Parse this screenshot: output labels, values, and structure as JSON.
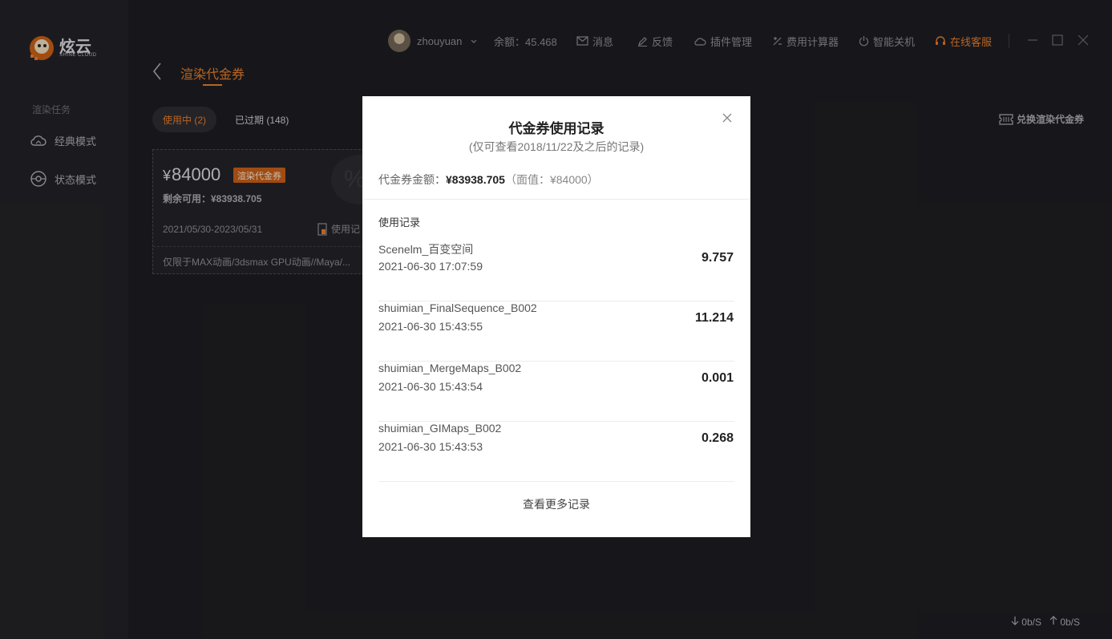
{
  "app": {
    "logo_text": "炫云",
    "logo_sub": "SHINE CLOUD"
  },
  "sidebar": {
    "section_label": "渲染任务",
    "items": [
      {
        "label": "经典模式",
        "icon": "cloud-icon"
      },
      {
        "label": "状态模式",
        "icon": "radar-icon"
      }
    ]
  },
  "topbar": {
    "username": "zhouyuan",
    "balance": "余额：45.468",
    "messages": "消息",
    "feedback": "反馈",
    "plugins": "插件管理",
    "calculator": "费用计算器",
    "shutdown": "智能关机",
    "support": "在线客服",
    "accent_color": "#e27a2b"
  },
  "page": {
    "title": "渲染代金券",
    "tabs": [
      {
        "label": "使用中 (2)",
        "active": true
      },
      {
        "label": "已过期 (148)",
        "active": false
      }
    ],
    "redeem_label": "兑换渲染代金券"
  },
  "voucher_card": {
    "currency": "¥",
    "amount": "84000",
    "tag": "渲染代金券",
    "remaining": "剩余可用：¥83938.705",
    "bg_symbol": "%",
    "date_range": "2021/05/30-2023/05/31",
    "use_record_label": "使用记",
    "limit_text": "仅限于MAX动画/3dsmax GPU动画//Maya/..."
  },
  "modal": {
    "title": "代金券使用记录",
    "subtitle": "(仅可查看2018/11/22及之后的记录)",
    "amount_label": "代金券金额：",
    "amount_value": "¥83938.705",
    "face_value": "（面值：¥84000）",
    "records_label": "使用记录",
    "records": [
      {
        "name": "Scenelm_百变空间",
        "time": "2021-06-30 17:07:59",
        "value": "9.757"
      },
      {
        "name": "shuimian_FinalSequence_B002",
        "time": "2021-06-30 15:43:55",
        "value": "11.214"
      },
      {
        "name": "shuimian_MergeMaps_B002",
        "time": "2021-06-30 15:43:54",
        "value": "0.001"
      },
      {
        "name": "shuimian_GIMaps_B002",
        "time": "2021-06-30 15:43:53",
        "value": "0.268"
      }
    ],
    "more_label": "查看更多记录"
  },
  "status": {
    "download": "0b/S",
    "upload": "0b/S"
  }
}
